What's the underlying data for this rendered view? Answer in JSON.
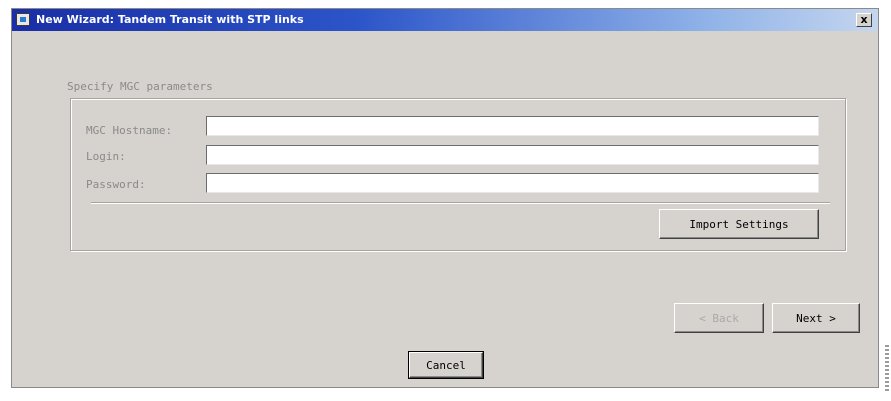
{
  "window": {
    "title": "New Wizard: Tandem Transit with STP links",
    "close_label": "x"
  },
  "section": {
    "label": "Specify MGC parameters"
  },
  "fields": [
    {
      "label": "MGC Hostname:",
      "value": "",
      "placeholder": ""
    },
    {
      "label": "Login:",
      "value": "",
      "placeholder": ""
    },
    {
      "label": "Password:",
      "value": "",
      "placeholder": ""
    }
  ],
  "buttons": {
    "import_settings": "Import Settings",
    "back": "< Back",
    "next": "Next >",
    "cancel": "Cancel"
  }
}
